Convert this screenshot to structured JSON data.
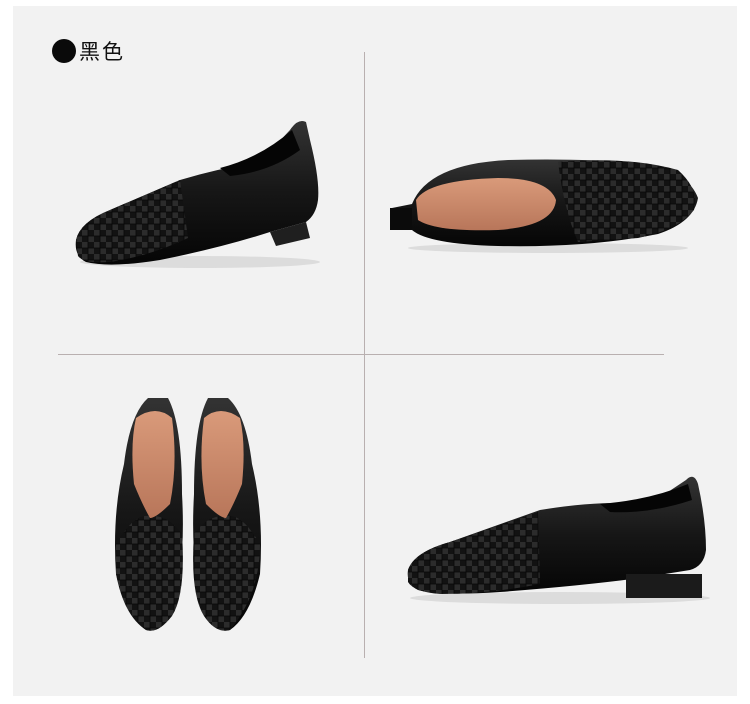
{
  "color_option": {
    "swatch_color": "#0a0a0a",
    "label": "黑色"
  },
  "colors": {
    "background": "#f2f2f2",
    "divider": "#b9b0b0",
    "leather": "#141414",
    "lining": "#c98a6a"
  }
}
